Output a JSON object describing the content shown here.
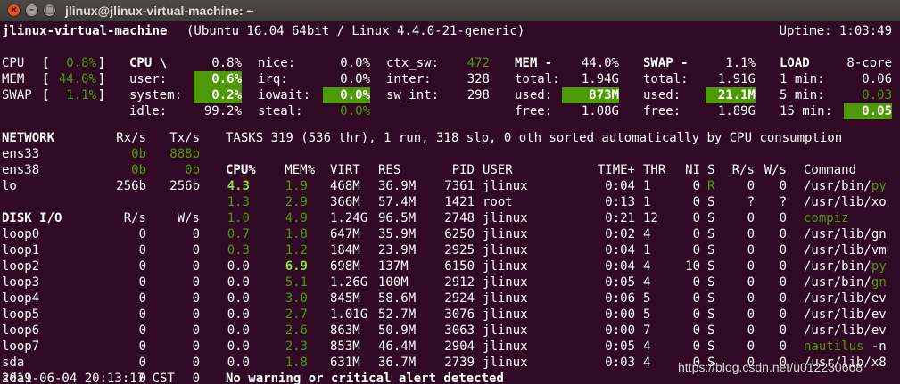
{
  "window": {
    "title": "jlinux@jlinux-virtual-machine: ~",
    "close_glyph": "×",
    "min_glyph": "–",
    "max_glyph": "□"
  },
  "header": {
    "hostname": "jlinux-virtual-machine",
    "system": "(Ubuntu 16.04 64bit / Linux 4.4.0-21-generic)",
    "uptime": "Uptime: 1:03:49"
  },
  "quicklook": {
    "rows": [
      {
        "label": "CPU",
        "open": "[",
        "value": "0.8%",
        "close": "]"
      },
      {
        "label": "MEM",
        "open": "[",
        "value": "44.0%",
        "close": "]"
      },
      {
        "label": "SWAP",
        "open": "[",
        "value": "1.1%",
        "close": "]"
      }
    ]
  },
  "cpu": {
    "title": "CPU \\",
    "total": "0.8%",
    "col1": [
      {
        "label": "user:",
        "value": "0.6%"
      },
      {
        "label": "system:",
        "value": "0.2%"
      },
      {
        "label": "idle:",
        "value": "99.2%"
      }
    ],
    "col2": [
      {
        "label": "nice:",
        "value": "0.0%"
      },
      {
        "label": "irq:",
        "value": "0.0%"
      },
      {
        "label": "iowait:",
        "value": "0.0%"
      },
      {
        "label": "steal:",
        "value": "0.0%"
      }
    ],
    "col3": [
      {
        "label": "ctx_sw:",
        "value": "472"
      },
      {
        "label": "inter:",
        "value": "328"
      },
      {
        "label": "sw_int:",
        "value": "298"
      }
    ]
  },
  "mem": {
    "title": "MEM -",
    "total_pct": "44.0%",
    "rows": [
      {
        "label": "total:",
        "value": "1.94G"
      },
      {
        "label": "used:",
        "value": "873M"
      },
      {
        "label": "free:",
        "value": "1.08G"
      }
    ]
  },
  "swap": {
    "title": "SWAP -",
    "total_pct": "1.1%",
    "rows": [
      {
        "label": "total:",
        "value": "1.91G"
      },
      {
        "label": "used:",
        "value": "21.1M"
      },
      {
        "label": "free:",
        "value": "1.89G"
      }
    ]
  },
  "load": {
    "title": "LOAD",
    "cores": "8-core",
    "rows": [
      {
        "label": "1 min:",
        "value": "0.06"
      },
      {
        "label": "5 min:",
        "value": "0.03"
      },
      {
        "label": "15 min:",
        "value": "0.05"
      }
    ]
  },
  "network": {
    "title": "NETWORK",
    "rx_header": "Rx/s",
    "tx_header": "Tx/s",
    "rows": [
      {
        "name": "ens33",
        "rx": "0b",
        "tx": "888b"
      },
      {
        "name": "ens38",
        "rx": "0b",
        "tx": "0b"
      },
      {
        "name": "lo",
        "rx": "256b",
        "tx": "256b"
      }
    ]
  },
  "diskio": {
    "title": "DISK I/O",
    "r_header": "R/s",
    "w_header": "W/s",
    "rows": [
      {
        "name": "loop0",
        "r": "0",
        "w": "0"
      },
      {
        "name": "loop1",
        "r": "0",
        "w": "0"
      },
      {
        "name": "loop2",
        "r": "0",
        "w": "0"
      },
      {
        "name": "loop3",
        "r": "0",
        "w": "0"
      },
      {
        "name": "loop4",
        "r": "0",
        "w": "0"
      },
      {
        "name": "loop5",
        "r": "0",
        "w": "0"
      },
      {
        "name": "loop6",
        "r": "0",
        "w": "0"
      },
      {
        "name": "loop7",
        "r": "0",
        "w": "0"
      },
      {
        "name": "sda",
        "r": "0",
        "w": "0"
      },
      {
        "name": "sda1",
        "r": "0",
        "w": "0"
      }
    ]
  },
  "tasks": {
    "summary": "TASKS 319 (536 thr), 1 run, 318 slp, 0 oth sorted automatically by CPU consumption"
  },
  "proc": {
    "headers": {
      "cpu": "CPU%",
      "mem": "MEM%",
      "virt": "VIRT",
      "res": "RES",
      "pid": "PID",
      "user": "USER",
      "time": "TIME+",
      "thr": "THR",
      "ni": "NI",
      "s": "S",
      "rs": "R/s",
      "ws": "W/s",
      "cmd": "Command"
    },
    "rows": [
      {
        "cpu": "4.3",
        "mem": "1.9",
        "virt": "468M",
        "res": "36.9M",
        "pid": "7361",
        "user": "jlinux",
        "time": "0:04",
        "thr": "1",
        "ni": "0",
        "s": "R",
        "rs": "0",
        "ws": "0",
        "cmd": "/usr/bin/",
        "cmd2": "py"
      },
      {
        "cpu": "1.3",
        "mem": "2.9",
        "virt": "366M",
        "res": "57.4M",
        "pid": "1421",
        "user": "root",
        "time": "0:13",
        "thr": "1",
        "ni": "0",
        "s": "S",
        "rs": "?",
        "ws": "?",
        "cmd": "/usr/lib/xo",
        "cmd2": ""
      },
      {
        "cpu": "1.0",
        "mem": "4.9",
        "virt": "1.24G",
        "res": "96.5M",
        "pid": "2748",
        "user": "jlinux",
        "time": "0:21",
        "thr": "12",
        "ni": "0",
        "s": "S",
        "rs": "0",
        "ws": "0",
        "cmd": "",
        "cmd2": "compiz"
      },
      {
        "cpu": "0.7",
        "mem": "1.8",
        "virt": "647M",
        "res": "35.9M",
        "pid": "6250",
        "user": "jlinux",
        "time": "0:02",
        "thr": "4",
        "ni": "0",
        "s": "S",
        "rs": "0",
        "ws": "0",
        "cmd": "/usr/lib/gn",
        "cmd2": ""
      },
      {
        "cpu": "0.3",
        "mem": "1.2",
        "virt": "184M",
        "res": "23.9M",
        "pid": "2925",
        "user": "jlinux",
        "time": "0:04",
        "thr": "1",
        "ni": "0",
        "s": "S",
        "rs": "0",
        "ws": "0",
        "cmd": "/usr/lib/vm",
        "cmd2": ""
      },
      {
        "cpu": "0.0",
        "mem": "6.9",
        "virt": "698M",
        "res": "137M",
        "pid": "6150",
        "user": "jlinux",
        "time": "0:04",
        "thr": "4",
        "ni": "10",
        "s": "S",
        "rs": "0",
        "ws": "0",
        "cmd": "/usr/bin/",
        "cmd2": "py"
      },
      {
        "cpu": "0.0",
        "mem": "5.1",
        "virt": "1.26G",
        "res": "100M",
        "pid": "2912",
        "user": "jlinux",
        "time": "0:05",
        "thr": "4",
        "ni": "0",
        "s": "S",
        "rs": "0",
        "ws": "0",
        "cmd": "/usr/bin/",
        "cmd2": "gn"
      },
      {
        "cpu": "0.0",
        "mem": "3.0",
        "virt": "845M",
        "res": "58.6M",
        "pid": "2924",
        "user": "jlinux",
        "time": "0:06",
        "thr": "5",
        "ni": "0",
        "s": "S",
        "rs": "0",
        "ws": "0",
        "cmd": "/usr/lib/ev",
        "cmd2": ""
      },
      {
        "cpu": "0.0",
        "mem": "2.7",
        "virt": "1.01G",
        "res": "52.7M",
        "pid": "3076",
        "user": "jlinux",
        "time": "0:00",
        "thr": "5",
        "ni": "0",
        "s": "S",
        "rs": "0",
        "ws": "0",
        "cmd": "/usr/lib/ev",
        "cmd2": ""
      },
      {
        "cpu": "0.0",
        "mem": "2.6",
        "virt": "863M",
        "res": "50.9M",
        "pid": "3063",
        "user": "jlinux",
        "time": "0:00",
        "thr": "7",
        "ni": "0",
        "s": "S",
        "rs": "0",
        "ws": "0",
        "cmd": "/usr/lib/ev",
        "cmd2": ""
      },
      {
        "cpu": "0.0",
        "mem": "2.3",
        "virt": "853M",
        "res": "46.4M",
        "pid": "2904",
        "user": "jlinux",
        "time": "0:05",
        "thr": "4",
        "ni": "0",
        "s": "S",
        "rs": "0",
        "ws": "0",
        "cmd": "",
        "cmd2": "nautilus",
        "cmd3": " -n"
      },
      {
        "cpu": "0.0",
        "mem": "1.8",
        "virt": "631M",
        "res": "36.7M",
        "pid": "2739",
        "user": "jlinux",
        "time": "0:03",
        "thr": "4",
        "ni": "0",
        "s": "S",
        "rs": "0",
        "ws": "0",
        "cmd": "/usr/lib/x8",
        "cmd2": ""
      }
    ]
  },
  "footer": {
    "datetime": "2019-06-04 20:13:17 CST",
    "alert": "No warning or critical alert detected",
    "watermark": "https://blog.csdn.net/u012230668"
  },
  "colors": {
    "background": "#300a24",
    "ok_green": "#4e9a06",
    "bright_green": "#8ae234",
    "titlebar": "#3c3b37",
    "close_button": "#e95420"
  }
}
